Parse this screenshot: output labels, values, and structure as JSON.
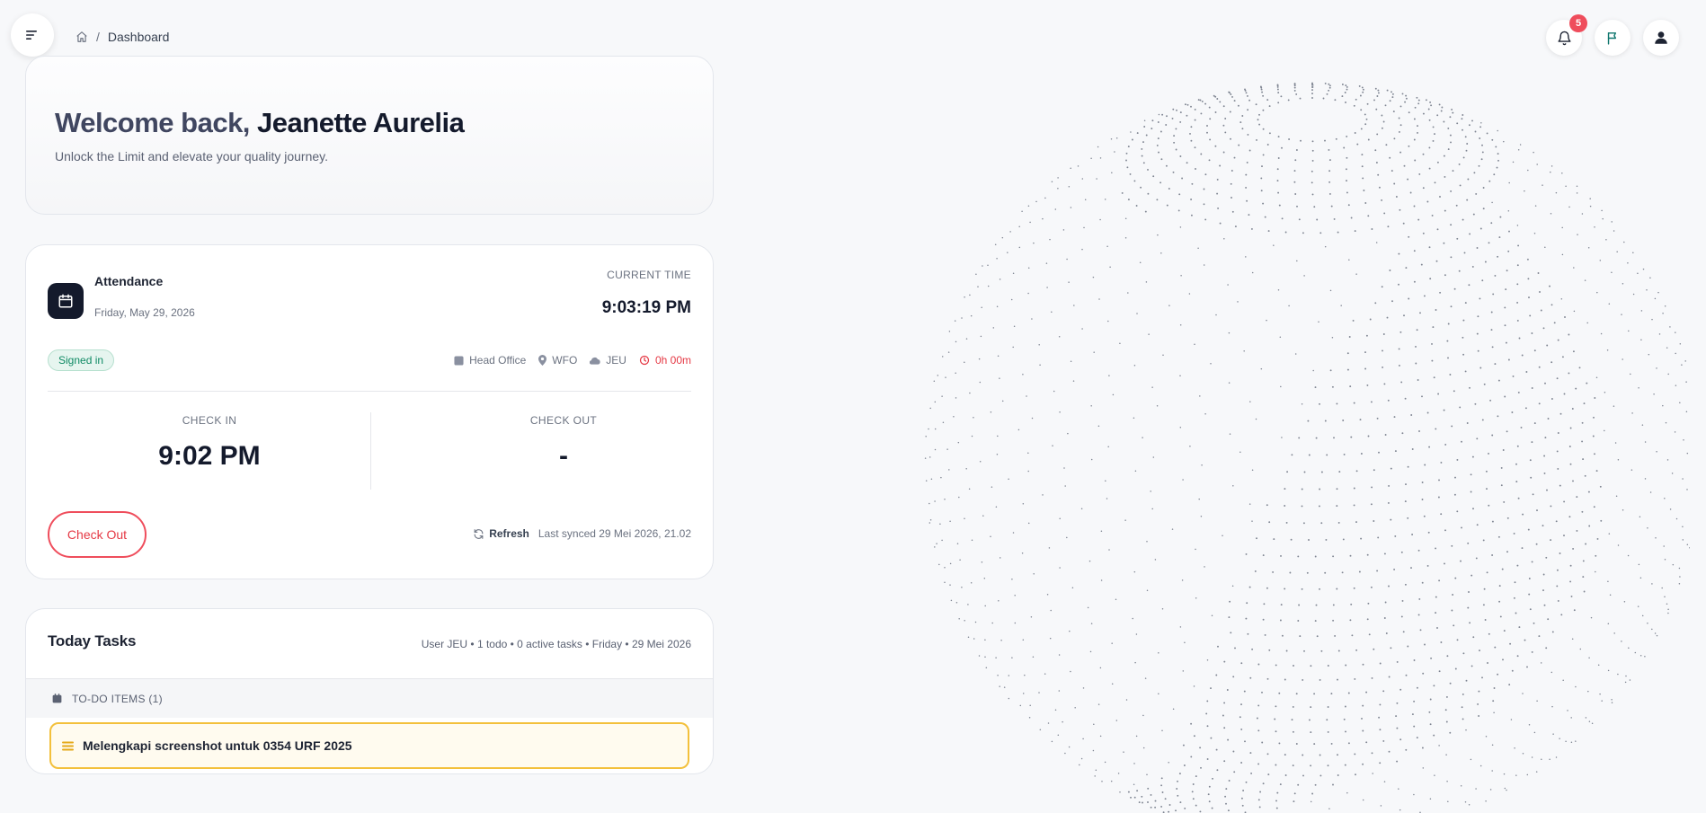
{
  "breadcrumb": {
    "current": "Dashboard"
  },
  "notifications": {
    "count": "5"
  },
  "welcome": {
    "greeting": "Welcome back,",
    "name": "Jeanette Aurelia",
    "subtitle": "Unlock the Limit and elevate your quality journey."
  },
  "attendance": {
    "title": "Attendance",
    "date": "Friday, May 29, 2026",
    "current_time_label": "CURRENT TIME",
    "current_time": "9:03:19 PM",
    "status": "Signed in",
    "office": "Head Office",
    "work_mode": "WFO",
    "unit": "JEU",
    "duration": "0h 00m",
    "check_in_label": "CHECK IN",
    "check_in_value": "9:02 PM",
    "check_out_label": "CHECK OUT",
    "check_out_value": "-",
    "check_out_button": "Check Out",
    "refresh_label": "Refresh",
    "last_synced": "Last synced 29 Mei 2026, 21.02"
  },
  "tasks": {
    "title": "Today Tasks",
    "meta": "User JEU • 1 todo • 0 active tasks • Friday • 29 Mei 2026",
    "todo_header": "TO-DO ITEMS (1)",
    "items": [
      {
        "label": "Melengkapi screenshot untuk 0354 URF 2025"
      }
    ]
  },
  "colors": {
    "accent_danger": "#ef4d5c",
    "success": "#0f8a64",
    "warning": "#f3c03b",
    "dark": "#141a2c"
  },
  "icons": [
    "menu-icon",
    "home-icon",
    "bell-icon",
    "flag-icon",
    "user-icon",
    "calendar-icon",
    "building-icon",
    "pin-icon",
    "cloud-icon",
    "clock-icon",
    "refresh-icon",
    "list-icon"
  ]
}
